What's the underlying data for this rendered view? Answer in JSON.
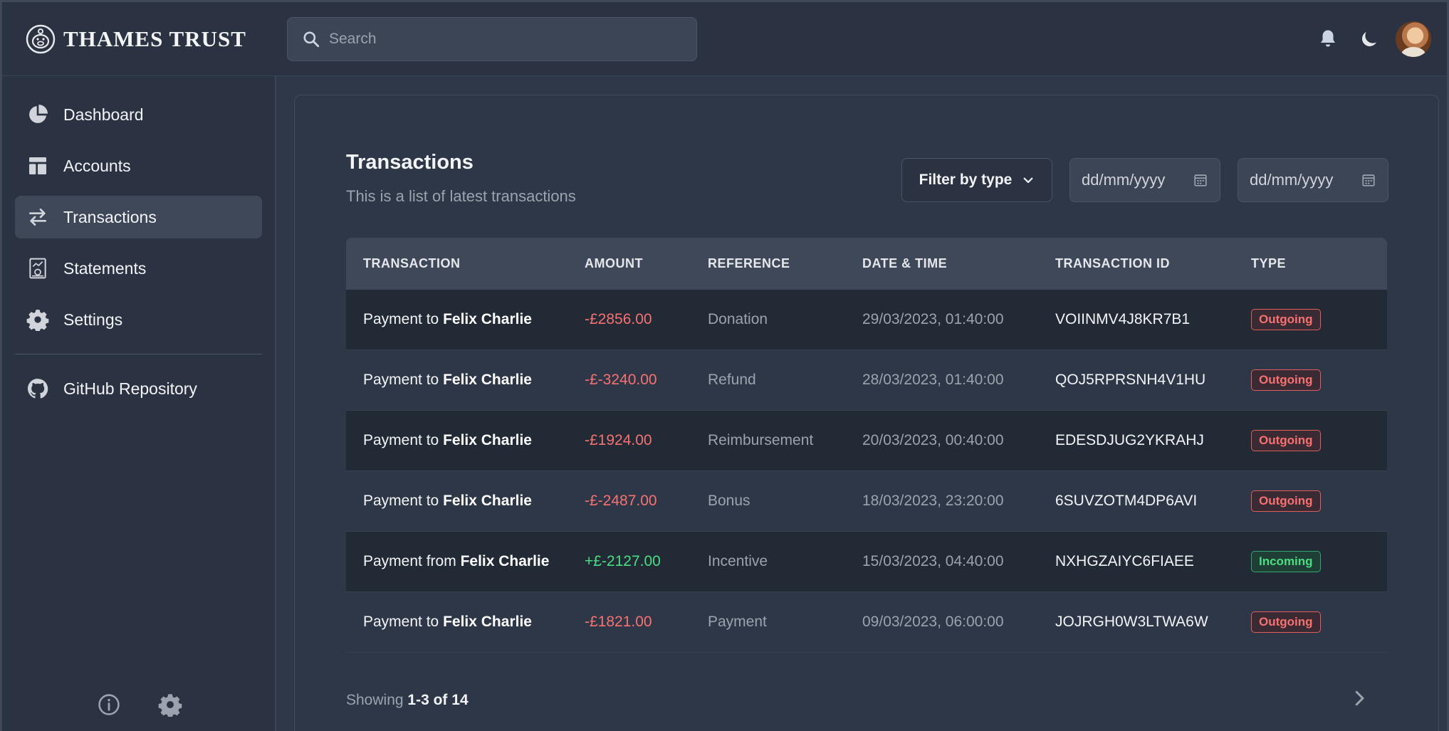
{
  "brand": {
    "name": "THAMES TRUST",
    "logo_icon": "piggy-bank-icon"
  },
  "search": {
    "placeholder": "Search"
  },
  "header": {
    "icons": [
      "bell-icon",
      "moon-icon"
    ],
    "avatar": "user-avatar"
  },
  "sidebar": {
    "items": [
      {
        "label": "Dashboard",
        "icon": "pie-chart-icon"
      },
      {
        "label": "Accounts",
        "icon": "layout-icon"
      },
      {
        "label": "Transactions",
        "icon": "arrows-swap-icon",
        "active": true
      },
      {
        "label": "Statements",
        "icon": "statement-icon"
      },
      {
        "label": "Settings",
        "icon": "gear-icon"
      }
    ],
    "external": {
      "label": "GitHub Repository",
      "icon": "github-icon"
    },
    "bottom_icons": [
      "info-icon",
      "gear-icon"
    ]
  },
  "main": {
    "title": "Transactions",
    "subtitle": "This is a list of latest transactions",
    "filter_label": "Filter by type",
    "date_from_placeholder": "dd/mm/yyyy",
    "date_to_placeholder": "dd/mm/yyyy",
    "columns": [
      "TRANSACTION",
      "AMOUNT",
      "REFERENCE",
      "DATE & TIME",
      "TRANSACTION ID",
      "TYPE"
    ],
    "rows": [
      {
        "prefix": "Payment to",
        "name": "Felix Charlie",
        "amount": "-£2856.00",
        "reference": "Donation",
        "datetime": "29/03/2023, 01:40:00",
        "txid": "VOIINMV4J8KR7B1",
        "type": "Outgoing"
      },
      {
        "prefix": "Payment to",
        "name": "Felix Charlie",
        "amount": "-£-3240.00",
        "reference": "Refund",
        "datetime": "28/03/2023, 01:40:00",
        "txid": "QOJ5RPRSNH4V1HU",
        "type": "Outgoing"
      },
      {
        "prefix": "Payment to",
        "name": "Felix Charlie",
        "amount": "-£1924.00",
        "reference": "Reimbursement",
        "datetime": "20/03/2023, 00:40:00",
        "txid": "EDESDJUG2YKRAHJ",
        "type": "Outgoing"
      },
      {
        "prefix": "Payment to",
        "name": "Felix Charlie",
        "amount": "-£-2487.00",
        "reference": "Bonus",
        "datetime": "18/03/2023, 23:20:00",
        "txid": "6SUVZOTM4DP6AVI",
        "type": "Outgoing"
      },
      {
        "prefix": "Payment from",
        "name": "Felix Charlie",
        "amount": "+£-2127.00",
        "reference": "Incentive",
        "datetime": "15/03/2023, 04:40:00",
        "txid": "NXHGZAIYC6FIAEE",
        "type": "Incoming"
      },
      {
        "prefix": "Payment to",
        "name": "Felix Charlie",
        "amount": "-£1821.00",
        "reference": "Payment",
        "datetime": "09/03/2023, 06:00:00",
        "txid": "JOJRGH0W3LTWA6W",
        "type": "Outgoing"
      }
    ],
    "footer": {
      "showing_label": "Showing",
      "range": "1-3",
      "of_label": "of",
      "total": "14"
    }
  },
  "colors": {
    "outgoing": "#f87171",
    "incoming": "#4ade80",
    "accent_bg": "#3e4859"
  }
}
